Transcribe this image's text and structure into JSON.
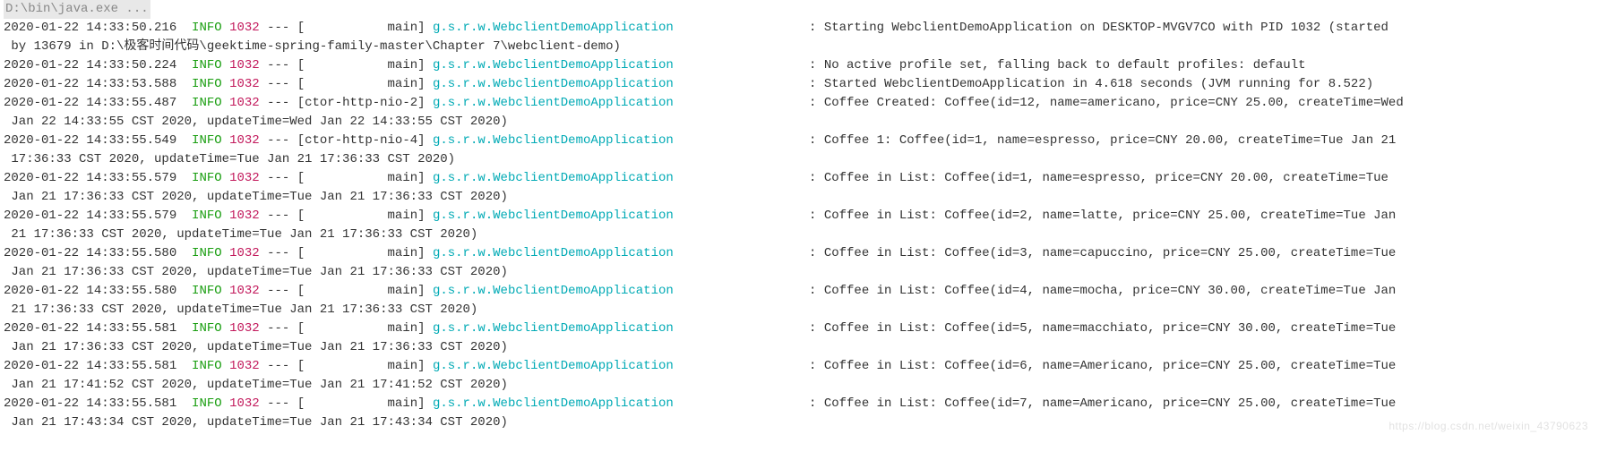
{
  "header": "D:\\bin\\java.exe ...",
  "watermark": "https://blog.csdn.net/weixin_43790623",
  "logger_name": "g.s.r.w.WebclientDemoApplication",
  "lines": [
    {
      "ts": "2020-01-22 14:33:50.216",
      "level": "INFO",
      "pid": "1032",
      "sep": "---",
      "thread": "[           main]",
      "msg": ": Starting WebclientDemoApplication on DESKTOP-MVGV7CO with PID 1032 (started",
      "cont": " by 13679 in D:\\极客时间代码\\geektime-spring-family-master\\Chapter 7\\webclient-demo)"
    },
    {
      "ts": "2020-01-22 14:33:50.224",
      "level": "INFO",
      "pid": "1032",
      "sep": "---",
      "thread": "[           main]",
      "msg": ": No active profile set, falling back to default profiles: default",
      "cont": ""
    },
    {
      "ts": "2020-01-22 14:33:53.588",
      "level": "INFO",
      "pid": "1032",
      "sep": "---",
      "thread": "[           main]",
      "msg": ": Started WebclientDemoApplication in 4.618 seconds (JVM running for 8.522)",
      "cont": ""
    },
    {
      "ts": "2020-01-22 14:33:55.487",
      "level": "INFO",
      "pid": "1032",
      "sep": "---",
      "thread": "[ctor-http-nio-2]",
      "msg": ": Coffee Created: Coffee(id=12, name=americano, price=CNY 25.00, createTime=Wed",
      "cont": " Jan 22 14:33:55 CST 2020, updateTime=Wed Jan 22 14:33:55 CST 2020)"
    },
    {
      "ts": "2020-01-22 14:33:55.549",
      "level": "INFO",
      "pid": "1032",
      "sep": "---",
      "thread": "[ctor-http-nio-4]",
      "msg": ": Coffee 1: Coffee(id=1, name=espresso, price=CNY 20.00, createTime=Tue Jan 21",
      "cont": " 17:36:33 CST 2020, updateTime=Tue Jan 21 17:36:33 CST 2020)"
    },
    {
      "ts": "2020-01-22 14:33:55.579",
      "level": "INFO",
      "pid": "1032",
      "sep": "---",
      "thread": "[           main]",
      "msg": ": Coffee in List: Coffee(id=1, name=espresso, price=CNY 20.00, createTime=Tue",
      "cont": " Jan 21 17:36:33 CST 2020, updateTime=Tue Jan 21 17:36:33 CST 2020)"
    },
    {
      "ts": "2020-01-22 14:33:55.579",
      "level": "INFO",
      "pid": "1032",
      "sep": "---",
      "thread": "[           main]",
      "msg": ": Coffee in List: Coffee(id=2, name=latte, price=CNY 25.00, createTime=Tue Jan",
      "cont": " 21 17:36:33 CST 2020, updateTime=Tue Jan 21 17:36:33 CST 2020)"
    },
    {
      "ts": "2020-01-22 14:33:55.580",
      "level": "INFO",
      "pid": "1032",
      "sep": "---",
      "thread": "[           main]",
      "msg": ": Coffee in List: Coffee(id=3, name=capuccino, price=CNY 25.00, createTime=Tue",
      "cont": " Jan 21 17:36:33 CST 2020, updateTime=Tue Jan 21 17:36:33 CST 2020)"
    },
    {
      "ts": "2020-01-22 14:33:55.580",
      "level": "INFO",
      "pid": "1032",
      "sep": "---",
      "thread": "[           main]",
      "msg": ": Coffee in List: Coffee(id=4, name=mocha, price=CNY 30.00, createTime=Tue Jan",
      "cont": " 21 17:36:33 CST 2020, updateTime=Tue Jan 21 17:36:33 CST 2020)"
    },
    {
      "ts": "2020-01-22 14:33:55.581",
      "level": "INFO",
      "pid": "1032",
      "sep": "---",
      "thread": "[           main]",
      "msg": ": Coffee in List: Coffee(id=5, name=macchiato, price=CNY 30.00, createTime=Tue",
      "cont": " Jan 21 17:36:33 CST 2020, updateTime=Tue Jan 21 17:36:33 CST 2020)"
    },
    {
      "ts": "2020-01-22 14:33:55.581",
      "level": "INFO",
      "pid": "1032",
      "sep": "---",
      "thread": "[           main]",
      "msg": ": Coffee in List: Coffee(id=6, name=Americano, price=CNY 25.00, createTime=Tue",
      "cont": " Jan 21 17:41:52 CST 2020, updateTime=Tue Jan 21 17:41:52 CST 2020)"
    },
    {
      "ts": "2020-01-22 14:33:55.581",
      "level": "INFO",
      "pid": "1032",
      "sep": "---",
      "thread": "[           main]",
      "msg": ": Coffee in List: Coffee(id=7, name=Americano, price=CNY 25.00, createTime=Tue",
      "cont": " Jan 21 17:43:34 CST 2020, updateTime=Tue Jan 21 17:43:34 CST 2020)"
    }
  ]
}
